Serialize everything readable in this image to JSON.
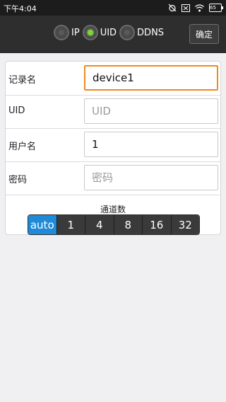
{
  "status_bar": {
    "time": "下午4:04",
    "battery": "65",
    "icons": [
      "alarm-off-icon",
      "sim-blocked-icon",
      "wifi-icon",
      "battery-icon"
    ]
  },
  "toolbar": {
    "modes": [
      {
        "label": "IP",
        "selected": false
      },
      {
        "label": "UID",
        "selected": true
      },
      {
        "label": "DDNS",
        "selected": false
      }
    ],
    "confirm_label": "确定"
  },
  "form": {
    "record_name": {
      "label": "记录名",
      "value": "device1",
      "placeholder": ""
    },
    "uid": {
      "label": "UID",
      "value": "",
      "placeholder": "UID"
    },
    "username": {
      "label": "用户名",
      "value": "1",
      "placeholder": ""
    },
    "password": {
      "label": "密码",
      "value": "",
      "placeholder": "密码"
    }
  },
  "channels": {
    "title": "通道数",
    "options": [
      "auto",
      "1",
      "4",
      "8",
      "16",
      "32"
    ],
    "selected": "auto"
  },
  "colors": {
    "accent_focus": "#f08a1c",
    "segment_active": "#1f8bd8",
    "radio_selected": "#7cd63a",
    "toolbar_bg": "#2e2e2e"
  }
}
